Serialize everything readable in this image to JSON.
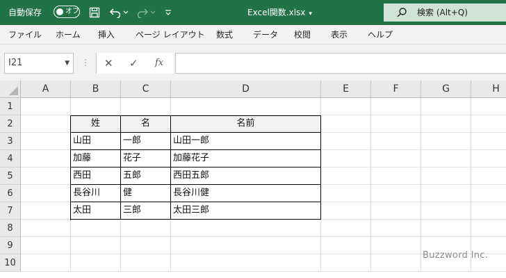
{
  "colors": {
    "accent": "#217346",
    "search_bg": "#cfe3d7",
    "header_bg": "#e9e9e9",
    "table_header_fill": "#f2f2f2"
  },
  "titlebar": {
    "autosave_label": "自動保存",
    "autosave_state": "オフ",
    "file_title": "Excel関数.xlsx",
    "search_text": "検索 (Alt+Q)",
    "icons": [
      "save-icon",
      "undo-icon",
      "redo-icon",
      "customize-icon"
    ]
  },
  "ribbon": {
    "tabs": [
      "ファイル",
      "ホーム",
      "挿入",
      "ページ レイアウト",
      "数式",
      "データ",
      "校閲",
      "表示",
      "ヘルプ"
    ]
  },
  "formula_bar": {
    "name_box": "I21",
    "formula": "",
    "fx_label": "fx"
  },
  "sheet": {
    "columns": [
      "A",
      "B",
      "C",
      "D",
      "E",
      "F",
      "G",
      "H"
    ],
    "rows": [
      "1",
      "2",
      "3",
      "4",
      "5",
      "6",
      "7",
      "8",
      "9",
      "10"
    ],
    "table_header": [
      "姓",
      "名",
      "名前"
    ],
    "table_rows": [
      [
        "山田",
        "一郎",
        "山田一郎"
      ],
      [
        "加藤",
        "花子",
        "加藤花子"
      ],
      [
        "西田",
        "五郎",
        "西田五郎"
      ],
      [
        "長谷川",
        "健",
        "長谷川健"
      ],
      [
        "太田",
        "三郎",
        "太田三郎"
      ]
    ]
  },
  "watermark": "Buzzword Inc."
}
